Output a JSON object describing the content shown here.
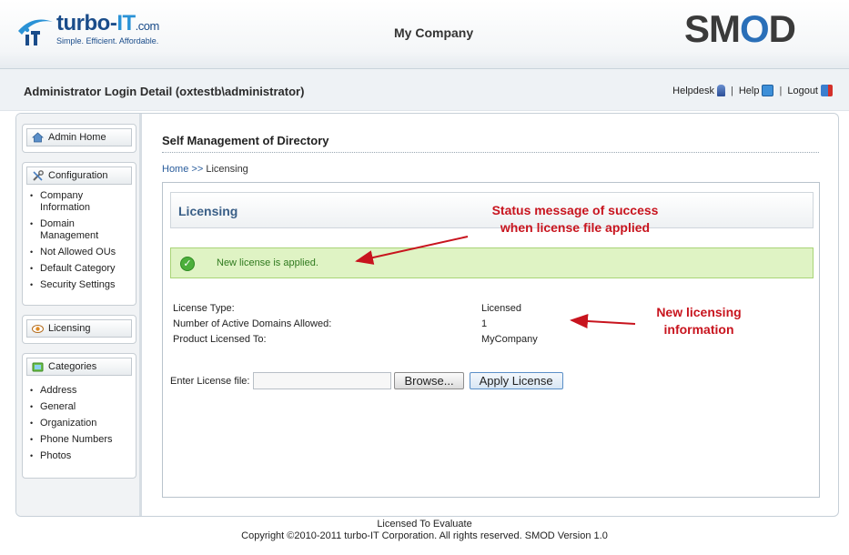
{
  "header": {
    "logo": {
      "brand_main": "turbo-",
      "brand_it": "IT",
      "brand_com": ".com",
      "tagline": "Simple.  Efficient.  Affordable."
    },
    "company_name": "My Company",
    "product_logo": {
      "s": "SM",
      "o": "O",
      "d": "D"
    }
  },
  "login": {
    "title": "Administrator Login Detail (oxtestb\\administrator)",
    "links": {
      "helpdesk": "Helpdesk",
      "help": "Help",
      "logout": "Logout",
      "separator": "|"
    }
  },
  "sidebar": {
    "admin_home": "Admin Home",
    "configuration": {
      "title": "Configuration",
      "items": [
        "Company Information",
        "Domain Management",
        "Not Allowed OUs",
        "Default Category",
        "Security Settings"
      ]
    },
    "licensing": "Licensing",
    "categories": {
      "title": "Categories",
      "items": [
        "Address",
        "General",
        "Organization",
        "Phone Numbers",
        "Photos"
      ]
    }
  },
  "main": {
    "section_title": "Self Management of Directory",
    "breadcrumb": {
      "home": "Home",
      "sep": ">>",
      "current": "Licensing"
    },
    "panel_title": "Licensing",
    "success_message": "New license is applied.",
    "info": [
      {
        "label": "License Type:",
        "value": "Licensed"
      },
      {
        "label": "Number of Active Domains Allowed:",
        "value": "1"
      },
      {
        "label": "Product Licensed To:",
        "value": "MyCompany"
      }
    ],
    "file_label": "Enter License file:",
    "browse_button": "Browse...",
    "apply_button": "Apply License"
  },
  "annotations": {
    "status_line1": "Status message of success",
    "status_line2": "when license file applied",
    "info_line1": "New licensing",
    "info_line2": "information"
  },
  "footer": {
    "line1": "Licensed To Evaluate",
    "line2": "Copyright ©2010-2011 turbo-IT Corporation. All rights reserved. SMOD Version 1.0"
  },
  "colors": {
    "annotation_red": "#c8141e",
    "success_bg": "#dff3c4",
    "link_blue": "#2a5d9c"
  }
}
